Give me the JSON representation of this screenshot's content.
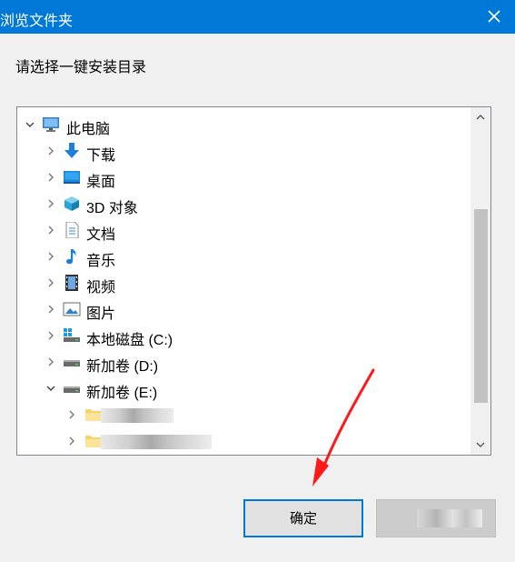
{
  "window": {
    "title": "浏览文件夹"
  },
  "instruction": "请选择一键安装目录",
  "tree": {
    "root": {
      "label": "此电脑",
      "icon": "computer-icon",
      "expanded": true
    },
    "items": [
      {
        "label": "下载",
        "icon": "downloads-icon",
        "expanded": false
      },
      {
        "label": "桌面",
        "icon": "desktop-icon",
        "expanded": false
      },
      {
        "label": "3D 对象",
        "icon": "3d-objects-icon",
        "expanded": false
      },
      {
        "label": "文档",
        "icon": "documents-icon",
        "expanded": false
      },
      {
        "label": "音乐",
        "icon": "music-icon",
        "expanded": false
      },
      {
        "label": "视频",
        "icon": "videos-icon",
        "expanded": false
      },
      {
        "label": "图片",
        "icon": "pictures-icon",
        "expanded": false
      },
      {
        "label": "本地磁盘 (C:)",
        "icon": "system-drive-icon",
        "expanded": false
      },
      {
        "label": "新加卷 (D:)",
        "icon": "drive-icon",
        "expanded": false
      },
      {
        "label": "新加卷 (E:)",
        "icon": "drive-icon",
        "expanded": true
      }
    ],
    "subfolders": [
      {
        "icon": "folder-icon",
        "label_obscured": true
      },
      {
        "icon": "folder-icon",
        "label_obscured": true
      }
    ]
  },
  "buttons": {
    "ok_label": "确定"
  },
  "colors": {
    "titlebar": "#0078d7",
    "focus_border": "#0078d7",
    "annotation_arrow": "#ff1a1a"
  }
}
